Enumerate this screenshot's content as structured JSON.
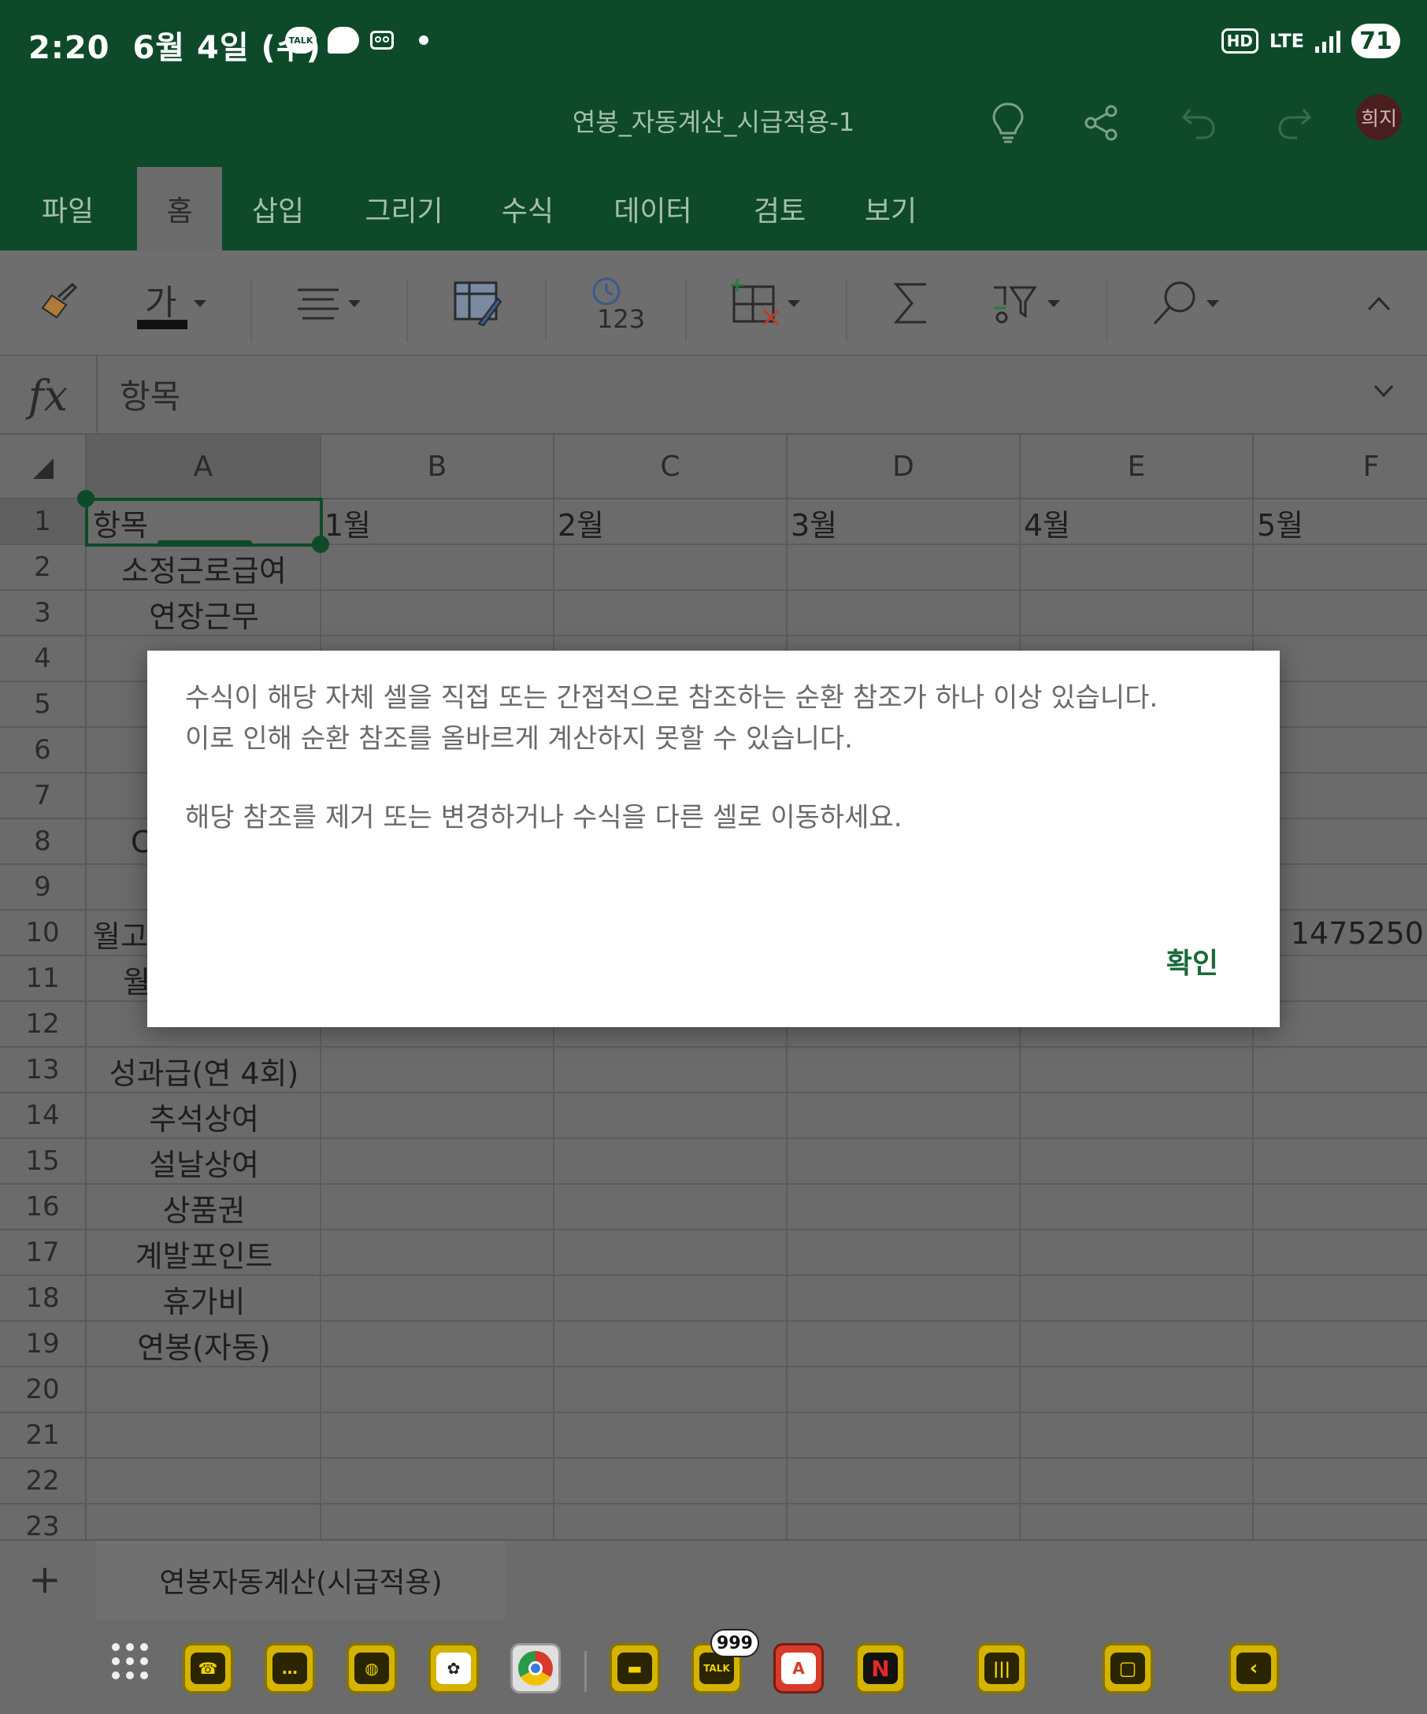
{
  "status_bar": {
    "time": "2:20",
    "date": "6월 4일 (수)",
    "notification_icons": [
      "talk-icon",
      "chat-bubble-icon",
      "voicemail-icon"
    ],
    "hd_label": "HD",
    "network_label": "LTE",
    "battery_level": "71"
  },
  "title_bar": {
    "document_title": "연봉_자동계산_시급적용-1",
    "avatar_initials": "희지"
  },
  "tabs": [
    "파일",
    "홈",
    "삽입",
    "그리기",
    "수식",
    "데이터",
    "검토",
    "보기"
  ],
  "active_tab": "홈",
  "ribbon": {
    "font_color_glyph": "가",
    "number_format_glyph": "123"
  },
  "formula_bar": {
    "fx_label": "fx",
    "value": "항목"
  },
  "grid": {
    "columns": [
      "A",
      "B",
      "C",
      "D",
      "E",
      "F"
    ],
    "selected_column": "A",
    "selected_row": "1",
    "row_numbers": [
      "1",
      "2",
      "3",
      "4",
      "5",
      "6",
      "7",
      "8",
      "9",
      "10",
      "11",
      "12",
      "13",
      "14",
      "15",
      "16",
      "17",
      "18",
      "19",
      "20",
      "21",
      "22",
      "23"
    ],
    "row1_headers": {
      "A": "항목",
      "B": "1월",
      "C": "2월",
      "D": "3월",
      "E": "4월",
      "F": "5월"
    },
    "column_a": {
      "2": "소정근로급여",
      "3": "연장근무",
      "13": "성과급(연 4회)",
      "14": "추석상여",
      "15": "설날상여",
      "16": "상품권",
      "17": "계발포인트",
      "18": "휴가비",
      "19": "연봉(자동)"
    },
    "partial_visible": {
      "A8": "C",
      "A10": "월고",
      "A11": "월",
      "F10": "1475250"
    }
  },
  "sheet_bar": {
    "add_label": "+",
    "sheet_name": "연봉자동계산(시급적용)"
  },
  "dialog": {
    "message_line1": "수식이 해당 자체 셀을 직접 또는 간접적으로 참조하는 순환 참조가 하나 이상 있습니다.",
    "message_line2": "이로 인해 순환 참조를 올바르게 계산하지 못할 수 있습니다.",
    "message_line3": "해당 참조를 제거 또는 변경하거나 수식을 다른 셀로 이동하세요.",
    "ok_label": "확인"
  },
  "dock": {
    "apps": [
      "phone-icon",
      "messages-icon",
      "internet-icon",
      "chatgpt-icon",
      "chrome-icon",
      "files-icon",
      "kakaotalk-icon",
      "acrobat-icon",
      "netflix-icon",
      "recents-icon",
      "home-icon",
      "back-icon"
    ],
    "badge_count": "999",
    "talk_label": "TALK"
  },
  "colors": {
    "title_green": "#0e4a2a",
    "dialog_accent": "#1a6a3a",
    "dimmed_bg": "#6b6b6b"
  }
}
